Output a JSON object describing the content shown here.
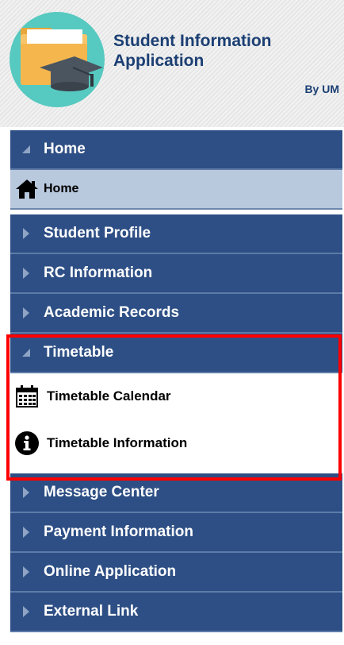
{
  "header": {
    "title": "Student Information Application",
    "byline": "By UM",
    "logo_icon": "folder-graduation-cap-logo"
  },
  "menu": {
    "home_section": {
      "label": "Home",
      "icon": "triangle-open-icon"
    },
    "home_item": {
      "label": "Home",
      "icon": "house-icon"
    },
    "sections": [
      {
        "label": "Student Profile",
        "icon": "triangle-right-icon"
      },
      {
        "label": "RC Information",
        "icon": "triangle-right-icon"
      },
      {
        "label": "Academic Records",
        "icon": "triangle-right-icon"
      }
    ],
    "timetable_section": {
      "label": "Timetable",
      "icon": "triangle-open-icon"
    },
    "timetable_items": [
      {
        "label": "Timetable Calendar",
        "icon": "calendar-icon"
      },
      {
        "label": "Timetable Information",
        "icon": "info-circle-icon"
      }
    ],
    "sections_after": [
      {
        "label": "Message Center",
        "icon": "triangle-right-icon"
      },
      {
        "label": "Payment Information",
        "icon": "triangle-right-icon"
      },
      {
        "label": "Online Application",
        "icon": "triangle-right-icon"
      },
      {
        "label": "External Link",
        "icon": "triangle-right-icon"
      }
    ]
  },
  "colors": {
    "section_bg": "#2e4f85",
    "home_item_bg": "#b8c8dd",
    "title_color": "#1b3f73",
    "highlight_border": "#ff0000"
  }
}
